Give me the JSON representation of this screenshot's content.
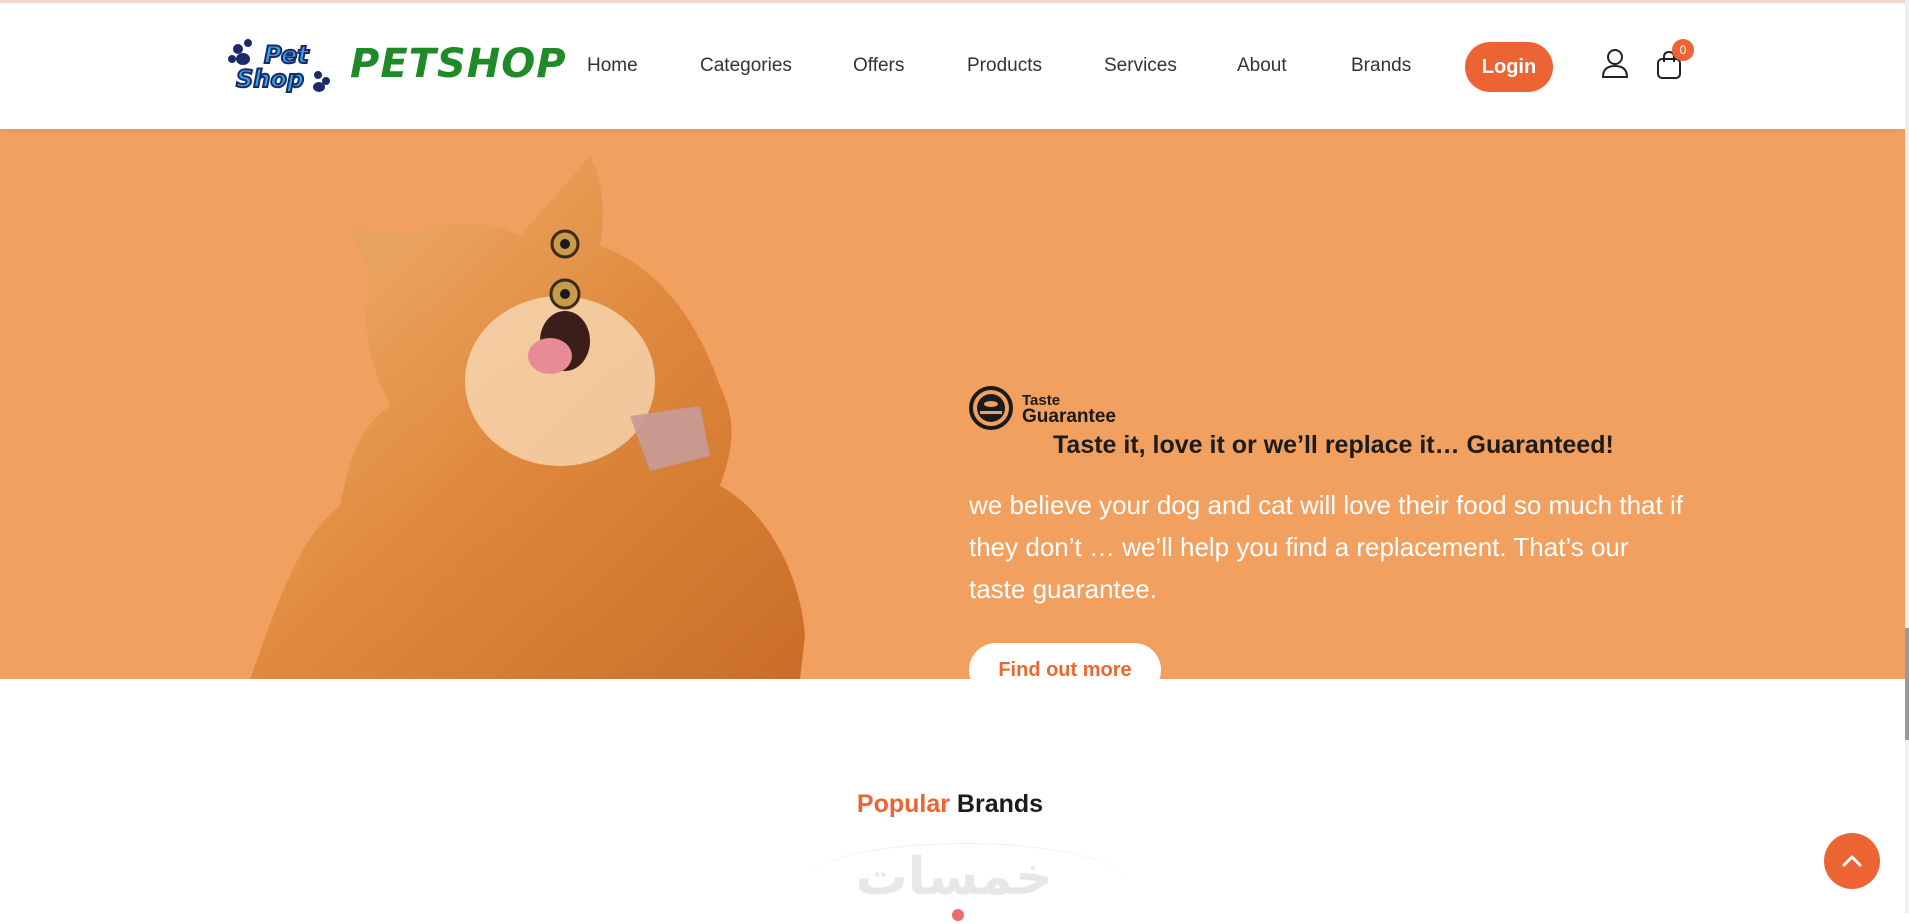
{
  "header": {
    "logo_badge_line1": "Pet",
    "logo_badge_line2": "Shop",
    "logo_text": "PETSHOP",
    "nav": [
      "Home",
      "Categories",
      "Offers",
      "Products",
      "Services",
      "About",
      "Brands"
    ],
    "login_label": "Login",
    "cart_count": "0",
    "icons": {
      "user": "user-icon",
      "cart": "cart-icon"
    }
  },
  "hero": {
    "badge_small_1": "Taste",
    "badge_small_2": "Guarantee",
    "headline": "Taste it, love it or we’ll replace it… Guaranteed!",
    "body": "we believe your dog and cat will love their food so much that if they don’t … we’ll help you find a replacement. That’s our taste guarantee.",
    "cta_label": "Find out more"
  },
  "brands": {
    "title_accent": "Popular",
    "title_rest": " Brands",
    "watermark": "خمسات"
  },
  "colors": {
    "accent": "#ec6433",
    "hero_bg": "#f2a05f",
    "logo_green": "#1f8a28"
  }
}
